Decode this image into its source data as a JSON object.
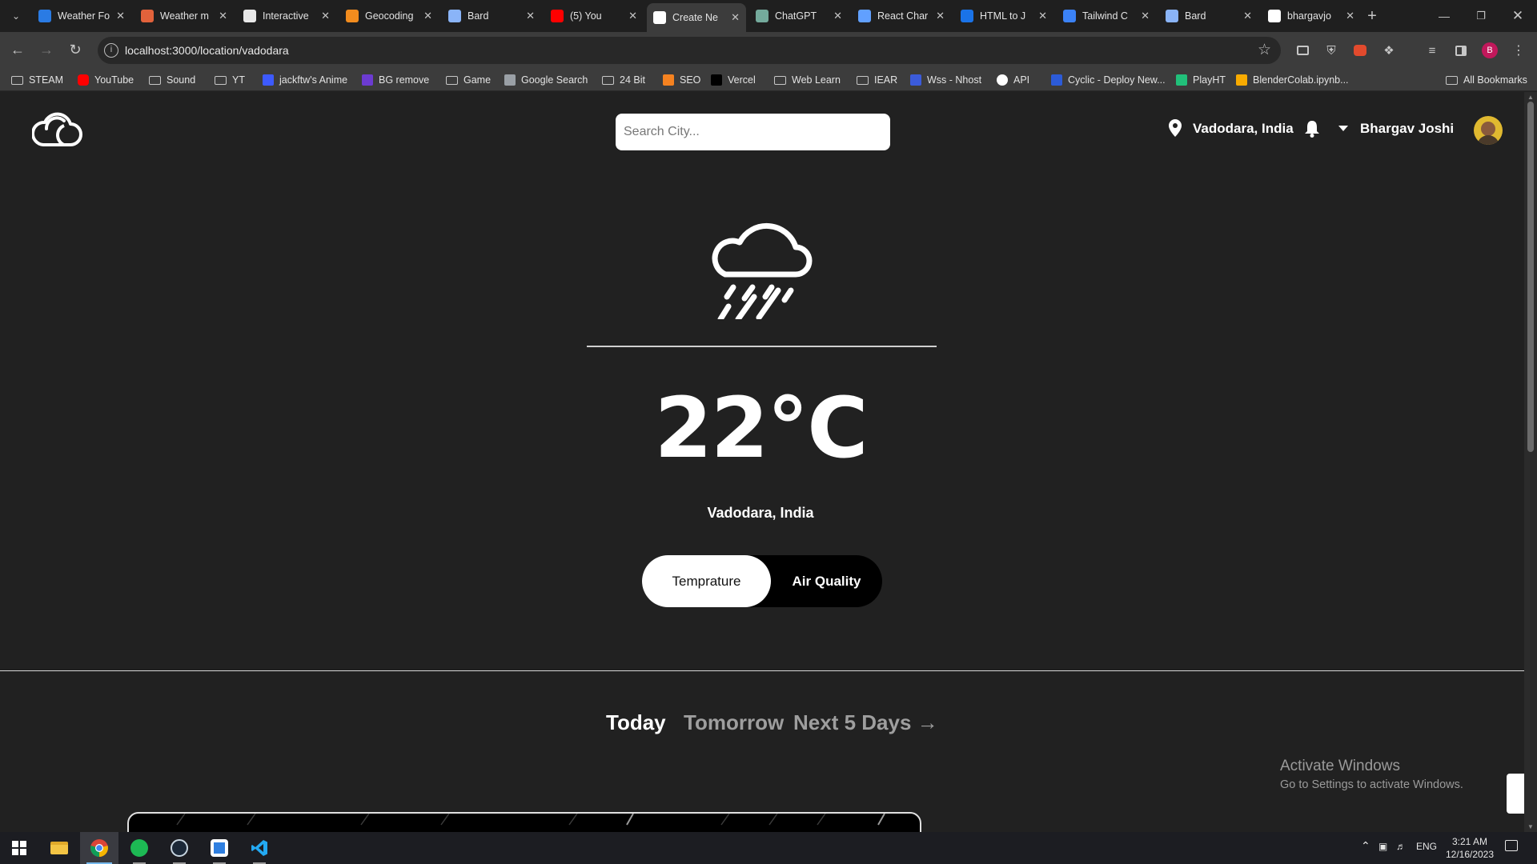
{
  "browser": {
    "tabs": [
      {
        "title": "Weather Fo",
        "favicon_color": "#2a7be4"
      },
      {
        "title": "Weather m",
        "favicon_color": "#e2623b"
      },
      {
        "title": "Interactive",
        "favicon_color": "#e8e8e8"
      },
      {
        "title": "Geocoding",
        "favicon_color": "#f28c1e"
      },
      {
        "title": "Bard",
        "favicon_color": "#8ab4f8"
      },
      {
        "title": "(5) You",
        "favicon_color": "#ff0000"
      },
      {
        "title": "Create Ne",
        "favicon_color": "#ffffff"
      },
      {
        "title": "ChatGPT",
        "favicon_color": "#74aa9c"
      },
      {
        "title": "React Char",
        "favicon_color": "#61a0ff"
      },
      {
        "title": "HTML to J",
        "favicon_color": "#1a73e8"
      },
      {
        "title": "Tailwind C",
        "favicon_color": "#3b82f6"
      },
      {
        "title": "Bard",
        "favicon_color": "#8ab4f8"
      },
      {
        "title": "bhargavjo",
        "favicon_color": "#ffffff"
      }
    ],
    "active_tab_index": 6,
    "url": "localhost:3000/location/vadodara",
    "profile_initial": "B",
    "bookmarks": [
      {
        "label": "STEAM",
        "icon": "folder"
      },
      {
        "label": "YouTube",
        "icon": "youtube",
        "color": "#ff0000"
      },
      {
        "label": "Sound",
        "icon": "folder"
      },
      {
        "label": "YT",
        "icon": "folder"
      },
      {
        "label": "jackftw's Anime",
        "icon": "site",
        "color": "#3d5afe"
      },
      {
        "label": "BG remove",
        "icon": "site",
        "color": "#6c3bd1"
      },
      {
        "label": "Game",
        "icon": "folder"
      },
      {
        "label": "Google Search",
        "icon": "site",
        "color": "#9aa0a6"
      },
      {
        "label": "24 Bit",
        "icon": "folder"
      },
      {
        "label": "SEO",
        "icon": "site",
        "color": "#f58220"
      },
      {
        "label": "Vercel",
        "icon": "site",
        "color": "#000000"
      },
      {
        "label": "Web Learn",
        "icon": "folder"
      },
      {
        "label": "IEAR",
        "icon": "folder"
      },
      {
        "label": "Wss - Nhost",
        "icon": "site",
        "color": "#3b5bdb"
      },
      {
        "label": "API",
        "icon": "github",
        "color": "#ffffff"
      },
      {
        "label": "Cyclic - Deploy New...",
        "icon": "site",
        "color": "#2c5bd8"
      },
      {
        "label": "PlayHT",
        "icon": "site",
        "color": "#21c07a"
      },
      {
        "label": "BlenderColab.ipynb...",
        "icon": "site",
        "color": "#f9ab00"
      }
    ],
    "all_bookmarks_label": "All Bookmarks"
  },
  "app": {
    "search_placeholder": "Search City...",
    "header_location": "Vadodara, India",
    "user_name": "Bhargav Joshi",
    "weather_icon": "cloud-rain-icon",
    "temperature": "22°C",
    "city": "Vadodara, India",
    "toggle": {
      "active": "Temprature",
      "inactive": "Air Quality"
    },
    "day_tabs": {
      "today": "Today",
      "tomorrow": "Tomorrow",
      "next": "Next 5 Days →"
    }
  },
  "os": {
    "watermark_title": "Activate Windows",
    "watermark_sub": "Go to Settings to activate Windows.",
    "tray_lang": "ENG",
    "time": "3:21 AM",
    "date": "12/16/2023"
  }
}
